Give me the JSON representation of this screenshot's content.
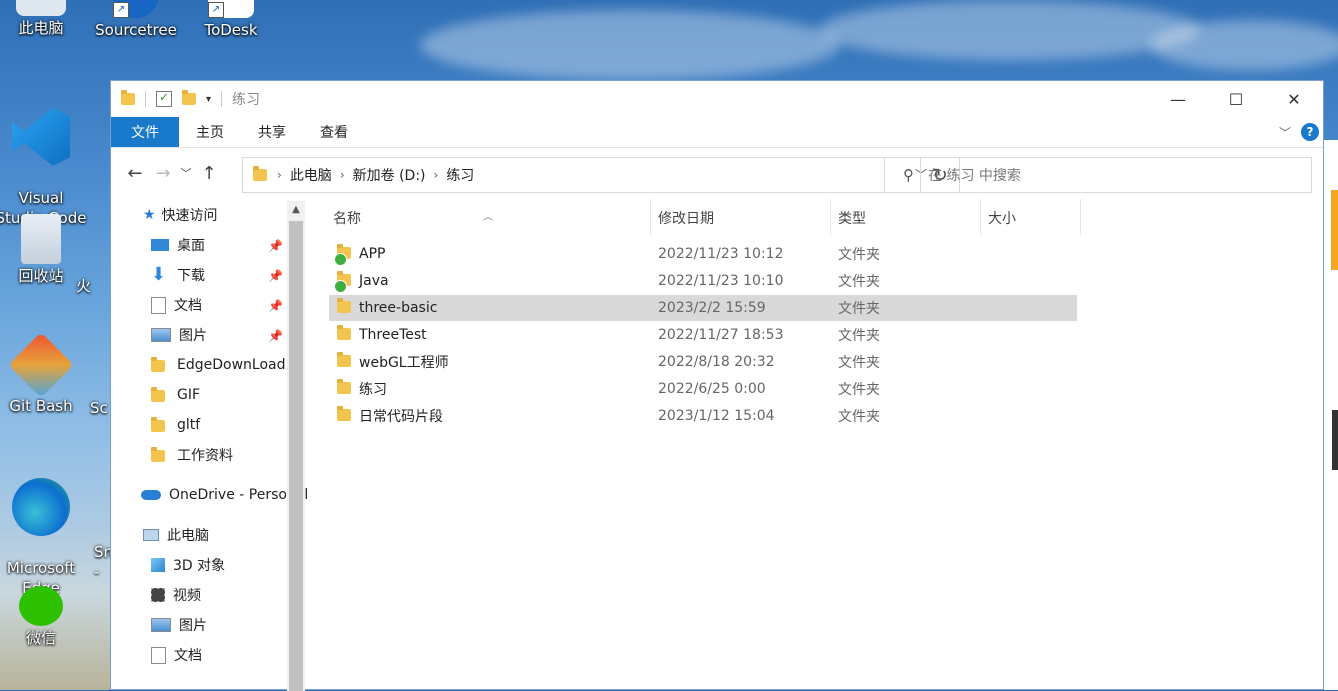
{
  "desktop": {
    "icons": [
      {
        "label": "此电脑",
        "icon": "computer-icon"
      },
      {
        "label": "Sourcetree",
        "icon": "sourcetree-icon"
      },
      {
        "label": "ToDesk",
        "icon": "todesk-icon"
      },
      {
        "label": "Visual\nStudio Code",
        "icon": "vscode-icon"
      },
      {
        "label": "回收站",
        "icon": "recycle-bin-icon"
      },
      {
        "label": "Git Bash",
        "icon": "git-bash-icon"
      },
      {
        "label": "Microsoft\nEdge",
        "icon": "edge-icon"
      },
      {
        "label": "微信",
        "icon": "wechat-icon"
      }
    ],
    "partial_labels": [
      "火",
      "Sc",
      "Sn\n-"
    ]
  },
  "window": {
    "title": "练习",
    "controls": {
      "minimize": "—",
      "maximize": "☐",
      "close": "✕"
    }
  },
  "ribbon": {
    "tabs": [
      "文件",
      "主页",
      "共享",
      "查看"
    ],
    "help": "?"
  },
  "address": {
    "crumbs": [
      "此电脑",
      "新加卷 (D:)",
      "练习"
    ]
  },
  "search": {
    "placeholder": "在 练习 中搜索"
  },
  "sidebar": {
    "quick_access": "快速访问",
    "items": [
      {
        "label": "桌面",
        "pinned": true
      },
      {
        "label": "下载",
        "pinned": true
      },
      {
        "label": "文档",
        "pinned": true
      },
      {
        "label": "图片",
        "pinned": true
      },
      {
        "label": "EdgeDownLoad",
        "pinned": false
      },
      {
        "label": "GIF",
        "pinned": false
      },
      {
        "label": "gltf",
        "pinned": false
      },
      {
        "label": "工作资料",
        "pinned": false
      }
    ],
    "onedrive": "OneDrive - Personal",
    "this_pc": "此电脑",
    "pc_items": [
      "3D 对象",
      "视频",
      "图片",
      "文档"
    ]
  },
  "columns": {
    "name": "名称",
    "date": "修改日期",
    "type": "类型",
    "size": "大小"
  },
  "files": [
    {
      "name": "APP",
      "date": "2022/11/23 10:12",
      "type": "文件夹",
      "synced": true,
      "selected": false
    },
    {
      "name": "Java",
      "date": "2022/11/23 10:10",
      "type": "文件夹",
      "synced": true,
      "selected": false
    },
    {
      "name": "three-basic",
      "date": "2023/2/2 15:59",
      "type": "文件夹",
      "synced": false,
      "selected": true
    },
    {
      "name": "ThreeTest",
      "date": "2022/11/27 18:53",
      "type": "文件夹",
      "synced": false,
      "selected": false
    },
    {
      "name": "webGL工程师",
      "date": "2022/8/18 20:32",
      "type": "文件夹",
      "synced": false,
      "selected": false
    },
    {
      "name": "练习",
      "date": "2022/6/25 0:00",
      "type": "文件夹",
      "synced": false,
      "selected": false
    },
    {
      "name": "日常代码片段",
      "date": "2023/1/12 15:04",
      "type": "文件夹",
      "synced": false,
      "selected": false
    }
  ],
  "colors": {
    "accent": "#1979ca",
    "folder": "#f3c44e",
    "selection": "#d9d9d9"
  }
}
